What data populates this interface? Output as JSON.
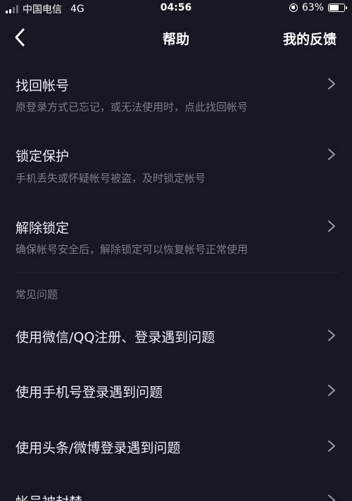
{
  "status": {
    "carrier": "中国电信",
    "network": "4G",
    "time": "04:56",
    "battery": "63%",
    "battery_level": 0.63,
    "icons": [
      "signal-icon",
      "rotation-lock-icon",
      "battery-icon"
    ]
  },
  "nav": {
    "title": "帮助",
    "action": "我的反馈",
    "back_icon": "chevron-left-icon"
  },
  "account_items": [
    {
      "title": "找回帐号",
      "subtitle": "原登录方式已忘记，或无法使用时，点此找回帐号"
    },
    {
      "title": "锁定保护",
      "subtitle": "手机丢失或怀疑帐号被盗，及时锁定帐号"
    },
    {
      "title": "解除锁定",
      "subtitle": "确保帐号安全后，解除锁定可以恢复帐号正常使用"
    }
  ],
  "faq": {
    "header": "常见问题",
    "items": [
      {
        "title": "使用微信/QQ注册、登录遇到问题"
      },
      {
        "title": "使用手机号登录遇到问题"
      },
      {
        "title": "使用头条/微博登录遇到问题"
      },
      {
        "title": "帐号被封禁"
      }
    ]
  },
  "colors": {
    "background": "#161722",
    "text": "#ececf2",
    "subtext": "#7d7e8a",
    "divider": "#2a2b38"
  }
}
